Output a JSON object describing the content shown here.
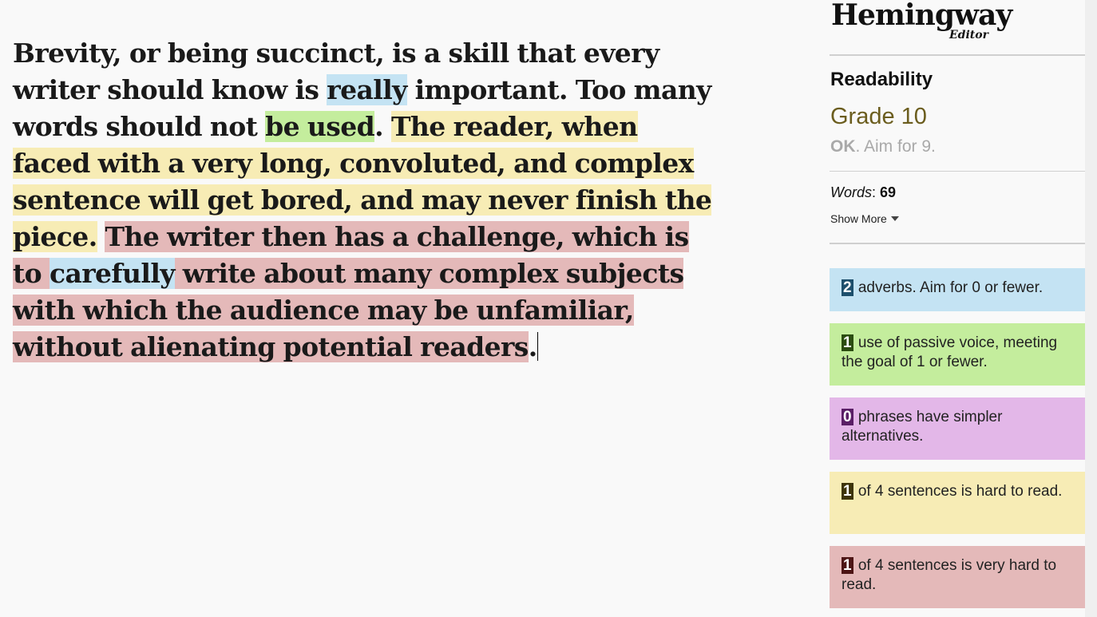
{
  "editor": {
    "segments": [
      {
        "text": "Brevity, or being succinct, is a skill that every writer should know is ",
        "type": "plain"
      },
      {
        "text": "really",
        "type": "adverb"
      },
      {
        "text": " important. Too many words should not ",
        "type": "plain"
      },
      {
        "text": "be used",
        "type": "passivevoice"
      },
      {
        "text": ". ",
        "type": "plain"
      },
      {
        "text": "The reader, when faced with a very long, convoluted, and complex sentence will get bored, and may never finish the piece.",
        "type": "hardreadability"
      },
      {
        "text": " ",
        "type": "plain"
      },
      {
        "text": "The writer then has a challenge, which is to ",
        "type": "veryhardreadability"
      },
      {
        "text": "carefully",
        "type": "adverb"
      },
      {
        "text": " write about many complex subjects with which the audience may be unfamiliar, without alienating potential readers",
        "type": "veryhardreadability"
      },
      {
        "text": ".",
        "type": "plain"
      }
    ]
  },
  "sidebar": {
    "logo": {
      "main": "Hemingway",
      "sub": "Editor"
    },
    "readability": {
      "title": "Readability",
      "grade": "Grade 10",
      "status": "OK",
      "aim": ". Aim for 9."
    },
    "words": {
      "label": "Words",
      "separator": ": ",
      "count": "69"
    },
    "show_more": "Show More",
    "cards": {
      "adverbs": {
        "count": "2",
        "text": "adverbs. Aim for 0 or fewer.",
        "color": "#c4e3f3"
      },
      "passive": {
        "count": "1",
        "text": "use of passive voice, meeting the goal of 1 or fewer.",
        "color": "#c4ed9d"
      },
      "phrases": {
        "count": "0",
        "text": "phrases have simpler alternatives.",
        "color": "#e3b7e8"
      },
      "hard": {
        "count": "1",
        "text": "of 4 sentences is hard to read.",
        "color": "#f7ecb5"
      },
      "veryhard": {
        "count": "1",
        "text": "of 4 sentences is very hard to read.",
        "color": "#e4b9b9"
      }
    }
  }
}
